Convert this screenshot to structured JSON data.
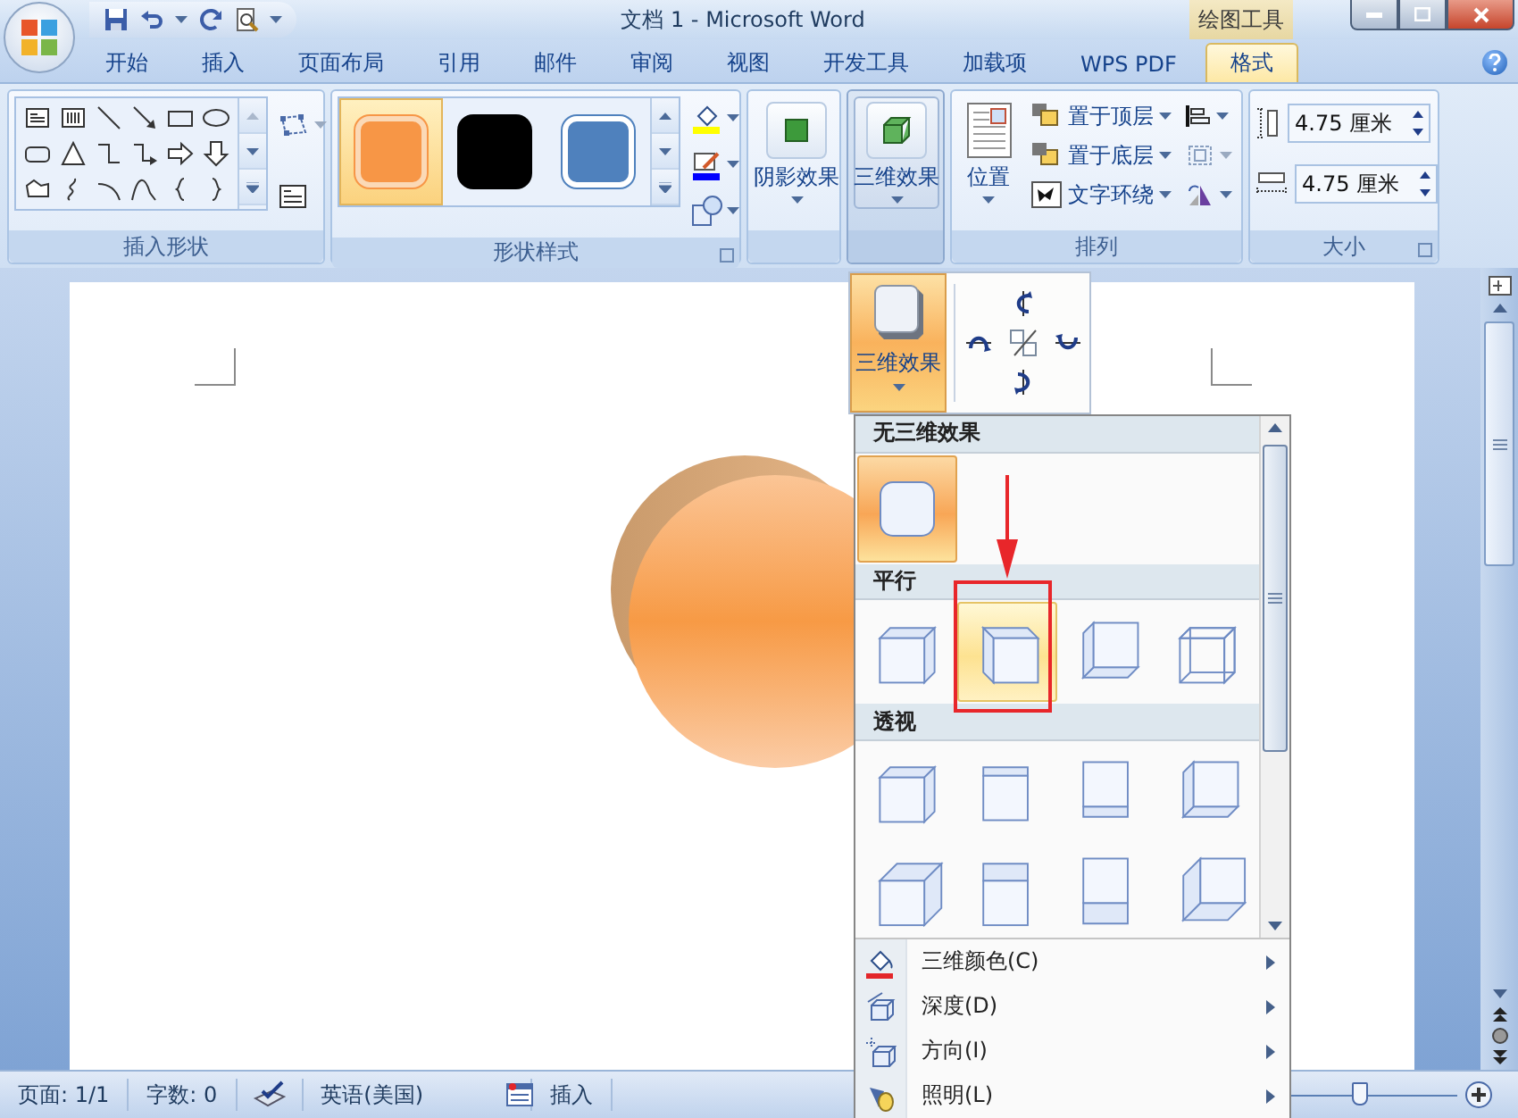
{
  "title_bar": {
    "title": "文档 1 - Microsoft Word",
    "context_tab": "绘图工具"
  },
  "tabs": [
    {
      "label": "开始",
      "selected": false
    },
    {
      "label": "插入",
      "selected": false
    },
    {
      "label": "页面布局",
      "selected": false
    },
    {
      "label": "引用",
      "selected": false
    },
    {
      "label": "邮件",
      "selected": false
    },
    {
      "label": "审阅",
      "selected": false
    },
    {
      "label": "视图",
      "selected": false
    },
    {
      "label": "开发工具",
      "selected": false
    },
    {
      "label": "加载项",
      "selected": false
    },
    {
      "label": "WPS PDF",
      "selected": false
    },
    {
      "label": "格式",
      "selected": true
    }
  ],
  "ribbon": {
    "insert_shapes": {
      "label": "插入形状"
    },
    "shape_styles": {
      "label": "形状样式",
      "styles": [
        {
          "color": "#f79646",
          "selected": true
        },
        {
          "color": "#000000",
          "selected": false
        },
        {
          "color": "#4f81bd",
          "selected": false
        }
      ]
    },
    "shadow_effects": {
      "label": "阴影效果",
      "pressed": false
    },
    "three_d_effects": {
      "label": "三维效果",
      "pressed": true
    },
    "arrange": {
      "label": "排列",
      "position": "位置",
      "commands": [
        {
          "kind": "front",
          "label": "置于顶层"
        },
        {
          "kind": "back",
          "label": "置于底层"
        },
        {
          "kind": "wrap",
          "label": "文字环绕"
        }
      ]
    },
    "size": {
      "label": "大小",
      "height": "4.75 厘米",
      "width": "4.75 厘米"
    }
  },
  "three_d_popup": {
    "button": {
      "label": "三维效果",
      "selected": true
    }
  },
  "three_d_menu": {
    "sections": [
      {
        "title": "无三维效果",
        "items": [
          {
            "selected": true,
            "hovered": false
          }
        ]
      },
      {
        "title": "平行",
        "items": [
          {
            "selected": false,
            "hovered": false
          },
          {
            "selected": false,
            "hovered": true
          },
          {
            "selected": false,
            "hovered": false
          },
          {
            "selected": false,
            "hovered": false
          }
        ]
      },
      {
        "title": "透视",
        "items": [
          {
            "selected": false,
            "hovered": false
          },
          {
            "selected": false,
            "hovered": false
          },
          {
            "selected": false,
            "hovered": false
          },
          {
            "selected": false,
            "hovered": false
          },
          {
            "selected": false,
            "hovered": false
          },
          {
            "selected": false,
            "hovered": false
          },
          {
            "selected": false,
            "hovered": false
          },
          {
            "selected": false,
            "hovered": false
          }
        ]
      }
    ],
    "commands": [
      {
        "kind": "color",
        "label": "三维颜色(C)"
      },
      {
        "kind": "depth",
        "label": "深度(D)"
      },
      {
        "kind": "direction",
        "label": "方向(I)"
      },
      {
        "kind": "lighting",
        "label": "照明(L)"
      }
    ]
  },
  "status_bar": {
    "page": "页面: 1/1",
    "words": "字数: 0",
    "language": "英语(美国)",
    "mode": "插入",
    "zoom": {
      "level": 0.5
    }
  }
}
